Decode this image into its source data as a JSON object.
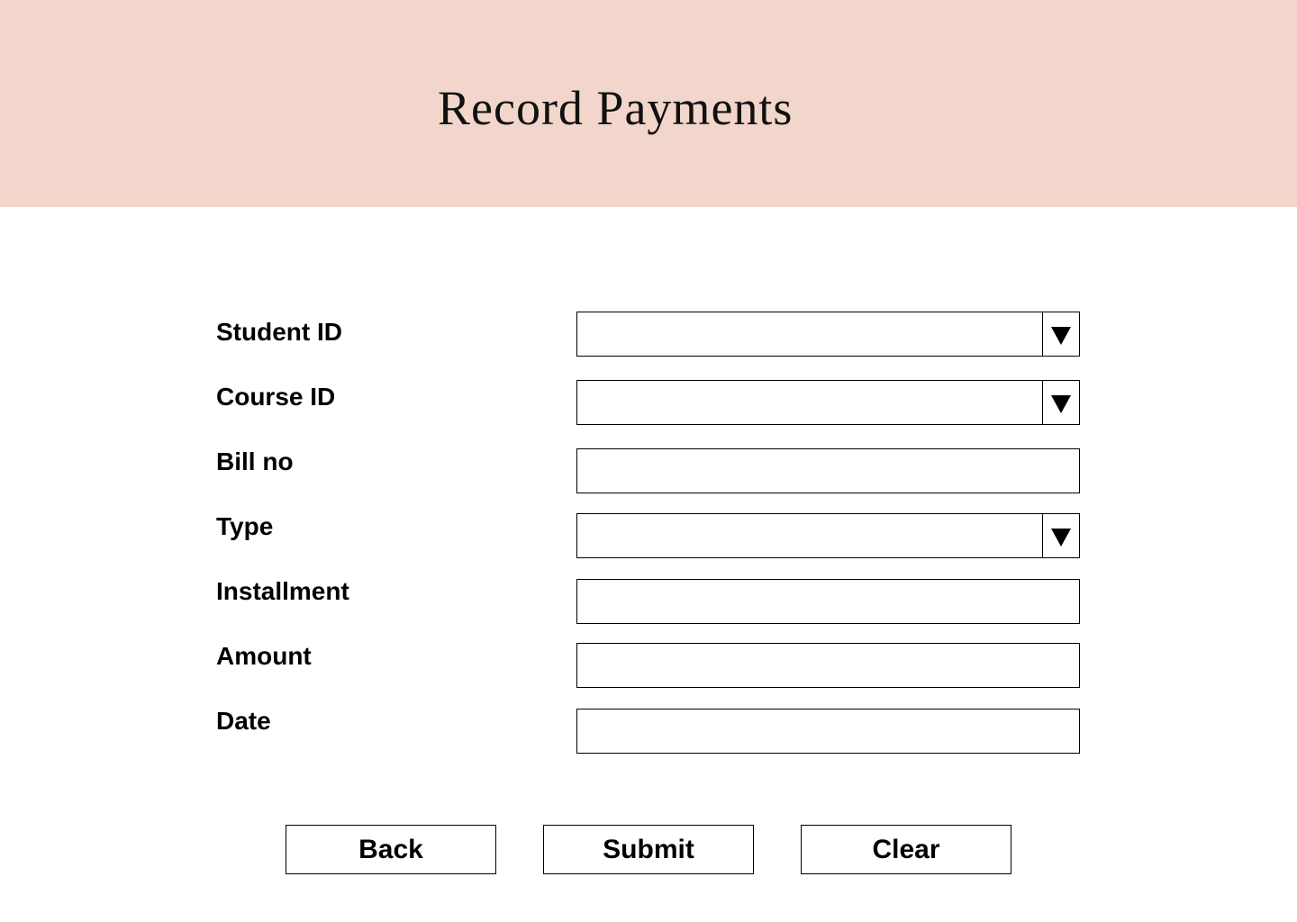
{
  "header": {
    "title": "Record Payments",
    "background": "#f2d6cb"
  },
  "form": {
    "fields": [
      {
        "label": "Student ID",
        "type": "select",
        "value": ""
      },
      {
        "label": "Course ID",
        "type": "select",
        "value": ""
      },
      {
        "label": "Bill no",
        "type": "text",
        "value": "",
        "placeholder": ""
      },
      {
        "label": "Type",
        "type": "select",
        "value": ""
      },
      {
        "label": "Installment",
        "type": "text",
        "value": "",
        "placeholder": ""
      },
      {
        "label": "Amount",
        "type": "text",
        "value": "",
        "placeholder": ""
      },
      {
        "label": "Date",
        "type": "text",
        "value": "",
        "placeholder": ""
      }
    ],
    "dropdown_icon": "triangle-down-icon"
  },
  "buttons": {
    "back_label": "Back",
    "submit_label": "Submit",
    "clear_label": "Clear"
  }
}
